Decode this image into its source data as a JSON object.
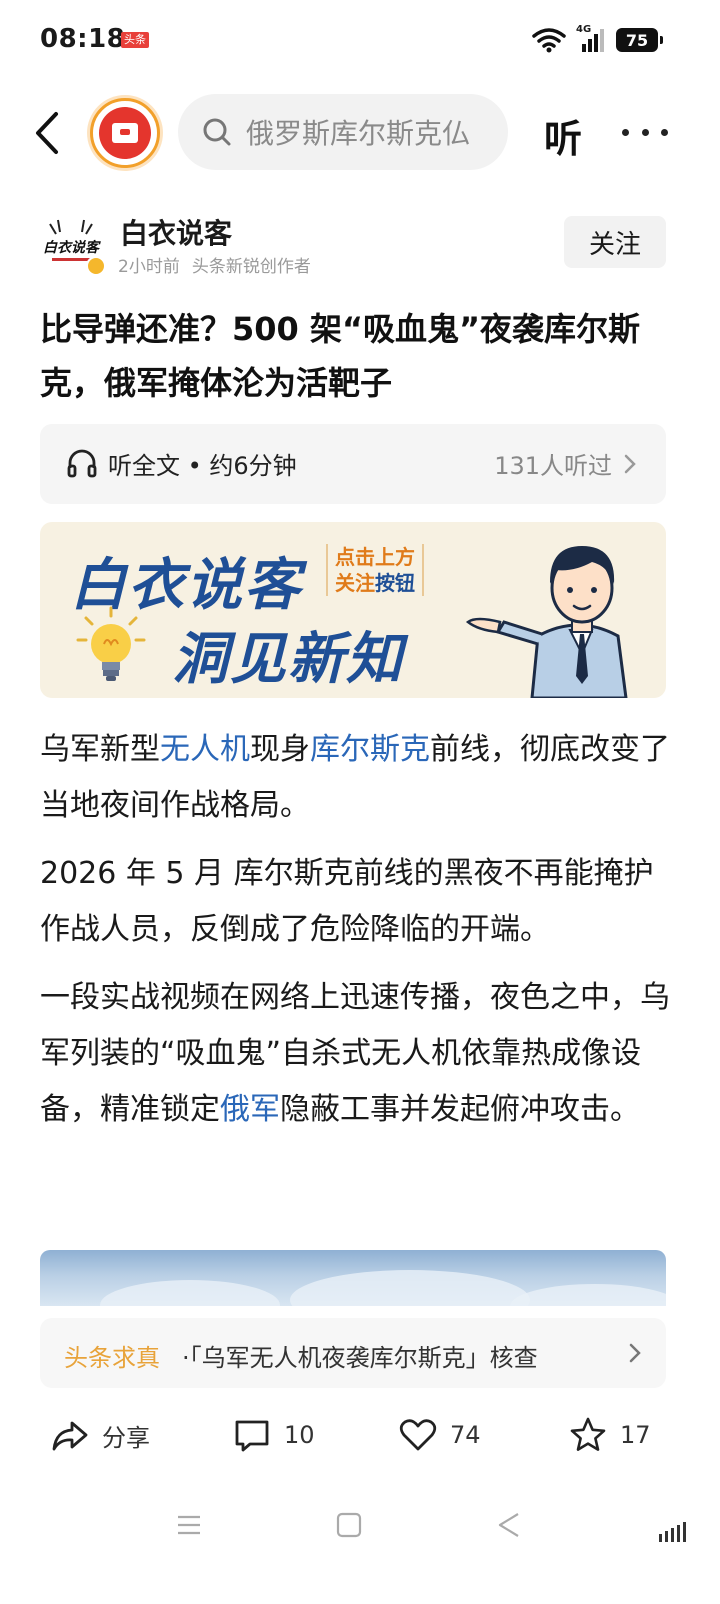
{
  "status_bar": {
    "time": "08:18",
    "app_badge": "头条",
    "network": "4G",
    "battery": "75"
  },
  "top_nav": {
    "search_placeholder": "俄罗斯库尔斯克仏",
    "listen_label": "听"
  },
  "author": {
    "name": "白衣说客",
    "time_ago": "2小时前",
    "role": "头条新锐创作者",
    "follow_label": "关注",
    "avatar_text": "白衣说客"
  },
  "article": {
    "title": "比导弹还准？500 架“吸血鬼”夜袭库尔斯克，俄军掩体沦为活靶子",
    "listen_bar": {
      "label": "听全文 • 约6分钟",
      "count": "131人听过"
    },
    "banner": {
      "line1": "白衣说客",
      "line2": "洞见新知",
      "tip_line1": "点击上方",
      "tip_line2a": "关注",
      "tip_line2b": "按钮"
    },
    "paragraphs": {
      "p1": {
        "a": "乌军新型",
        "link1": "无人机",
        "b": "现身",
        "link2": "库尔斯克",
        "c": "前线，彻底改变了当地夜间作战格局。"
      },
      "p2": "2026 年 5 月 库尔斯克前线的黑夜不再能掩护作战人员，反倒成了危险降临的开端。",
      "p3": {
        "a": "一段实战视频在网络上迅速传播，夜色之中，乌军列装的“吸血鬼”自杀式无人机依靠热成像设备，精准锁定",
        "link": "俄军",
        "b": "隐蔽工事并发起俯冲攻击。"
      }
    },
    "fact_check": {
      "tag": "头条求真",
      "text": "·「乌军无人机夜袭库尔斯克」核查"
    }
  },
  "actions": {
    "share_label": "分享",
    "comments": "10",
    "likes": "74",
    "favorites": "17"
  },
  "colors": {
    "link": "#2a67b8",
    "brand_red": "#e4352d",
    "fact_tag": "#e8a33a",
    "banner_blue": "#1f4f96"
  }
}
